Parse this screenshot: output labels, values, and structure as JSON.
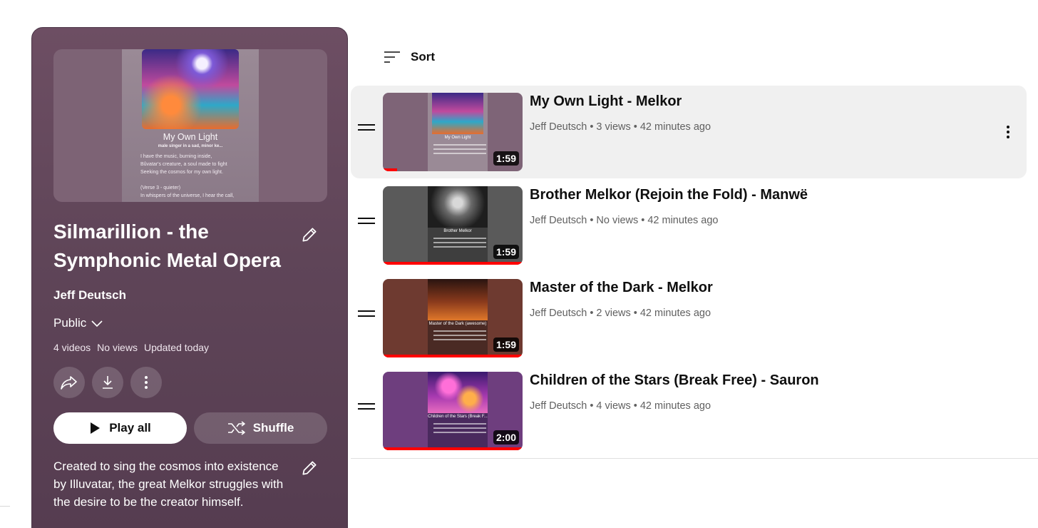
{
  "playlist": {
    "title": "Silmarillion - the Symphonic Metal Opera",
    "owner": "Jeff Deutsch",
    "privacy": "Public",
    "stats": {
      "videos": "4 videos",
      "views": "No views",
      "updated": "Updated today"
    },
    "description": "Created to sing the cosmos into existence by Illuvatar, the great Melkor struggles with the desire to be the creator himself.",
    "cover": {
      "title": "My Own Light",
      "subtitle": "male singer in a sad, minor ke...",
      "lines": [
        "I have the music, burning inside,",
        "Bûvatar's creature, a soul made to fight",
        "Seeking the cosmos for my own light.",
        "",
        "(Verse 3 - quieter)",
        "In whispers of the universe, I hear the call,"
      ]
    },
    "play_all_label": "Play all",
    "shuffle_label": "Shuffle"
  },
  "sort": {
    "label": "Sort"
  },
  "videos": [
    {
      "title": "My Own Light - Melkor",
      "channel": "Jeff Deutsch",
      "views": "3 views",
      "age": "42 minutes ago",
      "duration": "1:59",
      "thumb_caption": "My Own Light",
      "watched_fraction": 0.1,
      "selected": true
    },
    {
      "title": "Brother Melkor (Rejoin the Fold) - Manwë",
      "channel": "Jeff Deutsch",
      "views": "No views",
      "age": "42 minutes ago",
      "duration": "1:59",
      "thumb_caption": "Brother Melkor",
      "watched_fraction": 1.0,
      "selected": false
    },
    {
      "title": "Master of the Dark - Melkor",
      "channel": "Jeff Deutsch",
      "views": "2 views",
      "age": "42 minutes ago",
      "duration": "1:59",
      "thumb_caption": "Master of the Dark (awesome)",
      "watched_fraction": 1.0,
      "selected": false
    },
    {
      "title": "Children of the Stars (Break Free) - Sauron",
      "channel": "Jeff Deutsch",
      "views": "4 views",
      "age": "42 minutes ago",
      "duration": "2:00",
      "thumb_caption": "Children of the Stars (Break F...",
      "watched_fraction": 1.0,
      "selected": false
    }
  ],
  "icons": {
    "edit": "pencil-icon",
    "privacy_toggle": "chevron-down-icon",
    "share": "share-icon",
    "download": "download-icon",
    "more": "more-vert-icon",
    "play": "play-icon",
    "shuffle": "shuffle-icon",
    "sort": "sort-icon",
    "drag": "drag-handle-icon"
  },
  "colors": {
    "panel": "#5f4558",
    "progress": "#ff0000",
    "selected_row": "#f0f0f0"
  }
}
